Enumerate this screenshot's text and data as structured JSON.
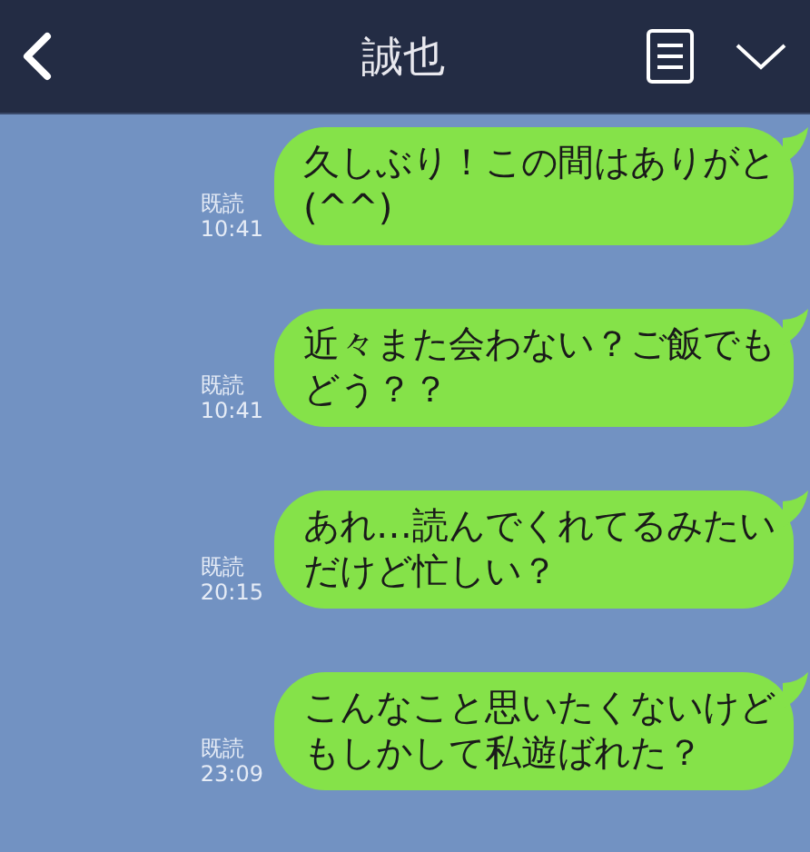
{
  "header": {
    "title": "誠也"
  },
  "messages": [
    {
      "text": "久しぶり！この間はありがと(^^)",
      "read_label": "既読",
      "time": "10:41"
    },
    {
      "text": "近々また会わない？ご飯でもどう？？",
      "read_label": "既読",
      "time": "10:41"
    },
    {
      "text": "あれ…読んでくれてるみたいだけど忙しい？",
      "read_label": "既読",
      "time": "20:15"
    },
    {
      "text": "こんなこと思いたくないけどもしかして私遊ばれた？",
      "read_label": "既読",
      "time": "23:09"
    }
  ]
}
